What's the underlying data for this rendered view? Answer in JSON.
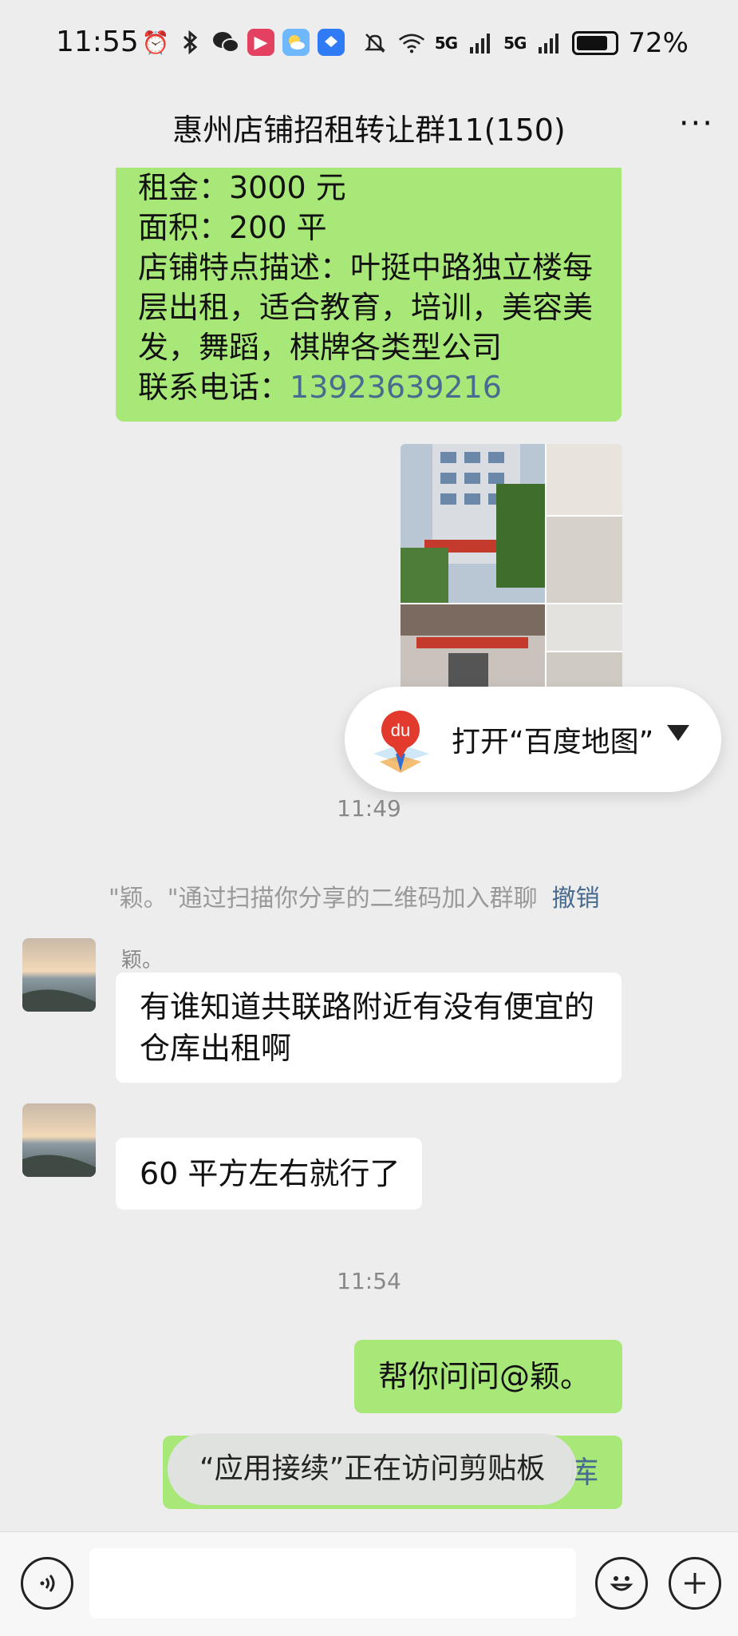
{
  "status_bar": {
    "time": "11:55",
    "battery": "72%",
    "signal1": "5G",
    "signal2": "5G",
    "blue_app_label": "HONOR"
  },
  "header": {
    "title": "惠州店铺招租转让群11(150)",
    "more": "···"
  },
  "messages": {
    "listing": {
      "rent": "租金：3000 元",
      "area": "面积：200 平",
      "desc1": "店铺特点描述：叶挺中路独立楼每",
      "desc2": "层出租，适合教育，培训，美容美",
      "desc3": "发，舞蹈，棋牌各类型公司",
      "phone_label": "联系电话：",
      "phone": "13923639216"
    },
    "time1": "11:49",
    "system": {
      "text": "\"颖。\"通过扫描你分享的二维码加入群聊",
      "undo": "撤销"
    },
    "msg1": {
      "nickname": "颖。",
      "line1": "有谁知道共联路附近有没有便宜的",
      "line2": "仓库出租啊"
    },
    "msg2": {
      "text": "60 平方左右就行了"
    },
    "time2": "11:54",
    "reply1": "帮你问问@颖。",
    "reply2_tail": "库"
  },
  "map_popup": {
    "label": "打开“百度地图”",
    "logo_text": "du"
  },
  "toast": "“应用接续”正在访问剪贴板",
  "colors": {
    "green_bubble": "#a8e878",
    "background": "#ededed",
    "link": "#486b8f"
  },
  "icons": [
    "alarm-icon",
    "bluetooth-icon",
    "wechat-icon",
    "video-app-icon",
    "weather-app-icon",
    "honor-app-icon",
    "mute-icon",
    "wifi-icon",
    "signal-icon",
    "battery-icon",
    "more-icon",
    "voice-icon",
    "emoji-icon",
    "plus-icon"
  ]
}
